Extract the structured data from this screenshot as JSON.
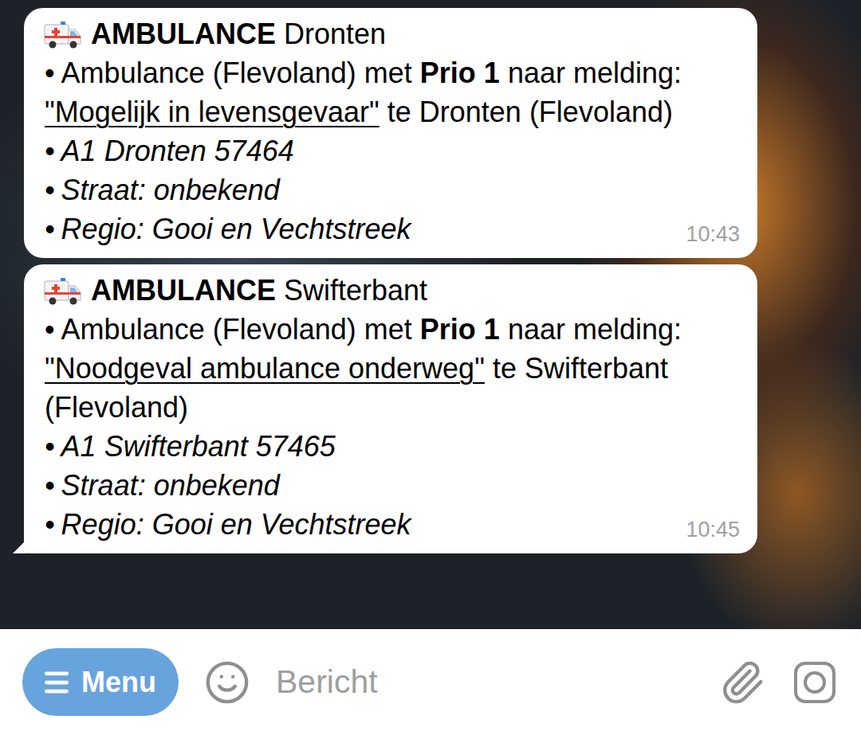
{
  "chat": {
    "messages": [
      {
        "title": "AMBULANCE",
        "place": "Dronten",
        "summary": {
          "bullet": "•",
          "prefix": "Ambulance (Flevoland) met",
          "priority": "Prio 1",
          "middle": "naar melding:",
          "link": "\"Mogelijk in levensgevaar\"",
          "suffix": "te Dronten (Flevoland)"
        },
        "details": [
          {
            "bullet": "•",
            "text": "A1 Dronten 57464"
          },
          {
            "bullet": "•",
            "text": "Straat: onbekend"
          },
          {
            "bullet": "•",
            "text": "Regio: Gooi en Vechtstreek"
          }
        ],
        "time": "10:43",
        "tail": false
      },
      {
        "title": "AMBULANCE",
        "place": "Swifterbant",
        "summary": {
          "bullet": "•",
          "prefix": "Ambulance (Flevoland) met",
          "priority": "Prio 1",
          "middle": "naar melding:",
          "link": "\"Noodgeval ambulance onderweg\"",
          "suffix": "te Swifterbant (Flevoland)"
        },
        "details": [
          {
            "bullet": "•",
            "text": "A1 Swifterbant 57465"
          },
          {
            "bullet": "•",
            "text": "Straat: onbekend"
          },
          {
            "bullet": "•",
            "text": "Regio: Gooi en Vechtstreek"
          }
        ],
        "time": "10:45",
        "tail": true
      }
    ]
  },
  "composer": {
    "menu_button": {
      "label": "Menu"
    },
    "placeholder": "Bericht"
  }
}
